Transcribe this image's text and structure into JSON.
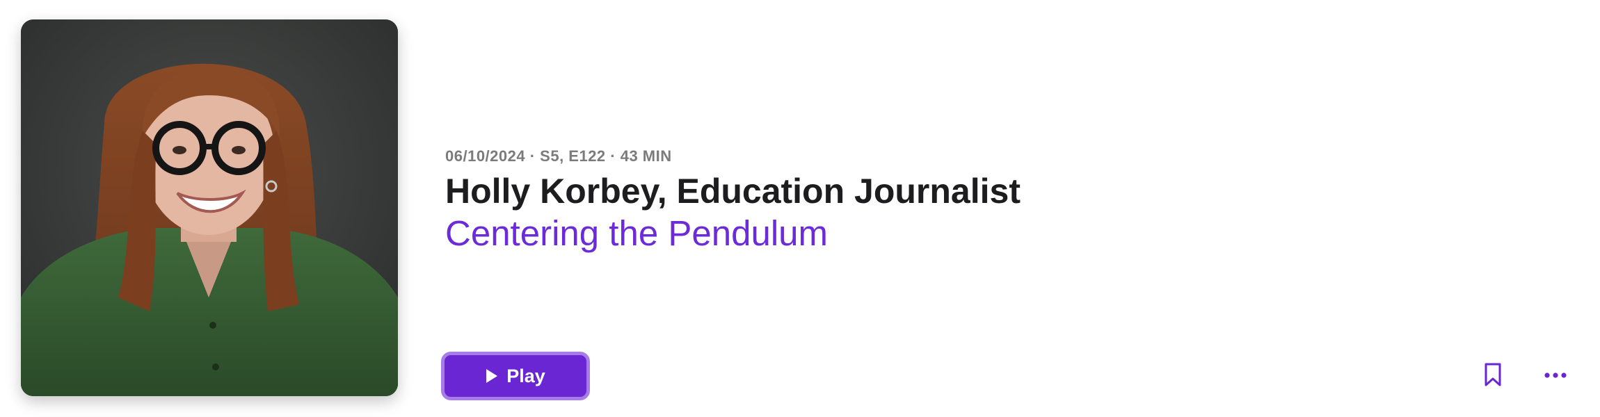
{
  "episode": {
    "meta": "06/10/2024 · S5, E122 · 43 MIN",
    "title": "Holly Korbey, Education Journalist",
    "subtitle": "Centering the Pendulum",
    "artwork_icon": "guest-portrait-image"
  },
  "actions": {
    "play_label": "Play",
    "play_icon": "play-icon",
    "bookmark_icon": "bookmark-icon",
    "more_icon": "ellipsis-icon"
  },
  "colors": {
    "accent": "#6a26d3",
    "accent_border": "#a77ce9",
    "subtitle": "#6c2bd9",
    "title": "#1d1d1f",
    "meta": "#7b7b7b"
  }
}
